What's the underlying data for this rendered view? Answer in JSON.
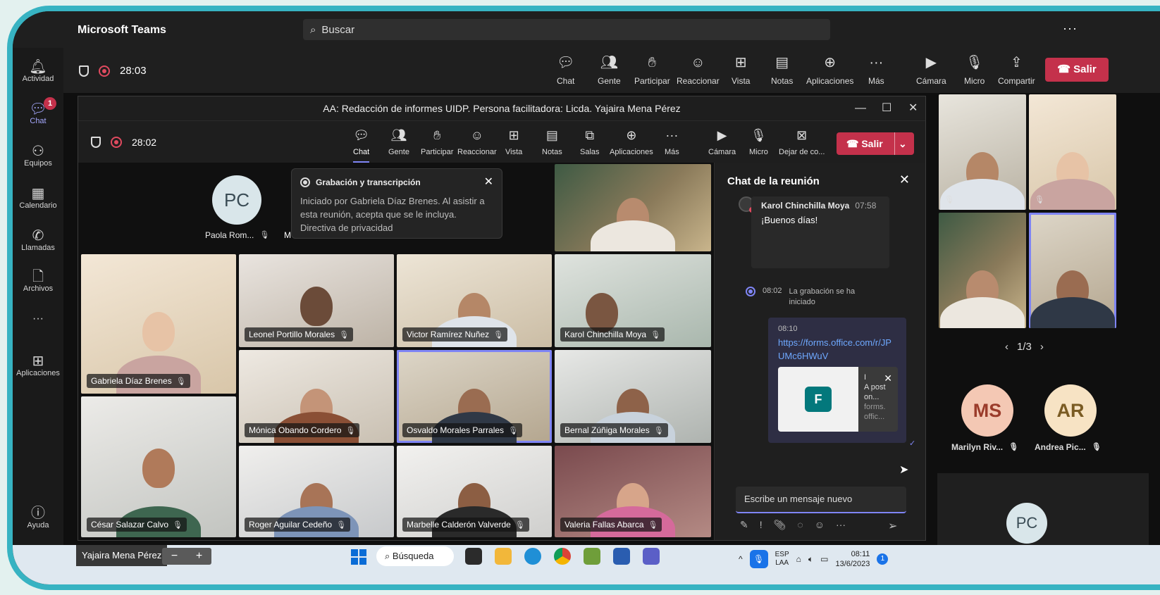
{
  "top": {
    "app_name": "Microsoft Teams",
    "search_placeholder": "Buscar",
    "more": "···"
  },
  "rail": [
    {
      "label": "Actividad",
      "icon": "bell-icon"
    },
    {
      "label": "Chat",
      "icon": "chat-icon",
      "badge": "1"
    },
    {
      "label": "Equipos",
      "icon": "teams-icon"
    },
    {
      "label": "Calendario",
      "icon": "calendar-icon"
    },
    {
      "label": "Llamadas",
      "icon": "phone-icon"
    },
    {
      "label": "Archivos",
      "icon": "file-icon"
    },
    {
      "label": "···",
      "icon": "more-icon"
    },
    {
      "label": "Aplicaciones",
      "icon": "apps-icon"
    },
    {
      "label": "Ayuda",
      "icon": "help-icon"
    }
  ],
  "toolbar": {
    "timer": "28:03",
    "buttons": [
      "Chat",
      "Gente",
      "Participar",
      "Reaccionar",
      "Vista",
      "Notas",
      "Aplicaciones",
      "Más",
      "Cámara",
      "Micro",
      "Compartir"
    ],
    "leave": "Salir"
  },
  "inner": {
    "title": "AA: Redacción de informes UIDP. Persona facilitadora: Licda. Yajaira Mena Pérez",
    "timer": "28:02",
    "buttons": [
      "Chat",
      "Gente",
      "Participar",
      "Reaccionar",
      "Vista",
      "Notas",
      "Salas",
      "Aplicaciones",
      "Más",
      "Cámara",
      "Micro",
      "Dejar de co..."
    ],
    "leave": "Salir"
  },
  "toast": {
    "title": "Grabación y transcripción",
    "body": "Iniciado por Gabriela Díaz Brenes. Al asistir a esta reunión, acepta que se le incluya. Directiva de privacidad"
  },
  "stage": {
    "pc_initials": "PC",
    "pc_name": "Paola Rom...",
    "m_cut": "M",
    "participants": [
      "Gabriela Díaz Brenes",
      "Leonel Portillo Morales",
      "Victor Ramírez Nuñez",
      "Karol Chinchilla Moya",
      "Mónica Obando Cordero",
      "Osvaldo Morales Parrales",
      "Bernal Zúñiga Morales",
      "César Salazar Calvo",
      "Roger Aguilar Cedeño",
      "Marbelle Calderón Valverde",
      "Valeria Fallas Abarca"
    ]
  },
  "chat": {
    "title": "Chat de la reunión",
    "msg1_author": "Karol Chinchilla Moya",
    "msg1_time": "07:58",
    "msg1_text": "¡Buenos días!",
    "sys_time": "08:02",
    "sys_text": "La grabación se ha iniciado",
    "msg2_time": "08:10",
    "msg2_link": "https://forms.office.com/r/JPUMc6HWuV",
    "card_text": "I",
    "card_desc": "A post on...",
    "card_domain": "forms. offic...",
    "compose_placeholder": "Escribe un mensaje nuevo"
  },
  "right": {
    "pager": "1/3",
    "ms_initials": "MS",
    "ms_name": "Marilyn Riv...",
    "ar_initials": "AR",
    "ar_name": "Andrea Pic...",
    "pc_initials": "PC"
  },
  "taskbar": {
    "user": "Yajaira Mena Pérez",
    "search": "Búsqueda",
    "lang1": "ESP",
    "lang2": "LAA",
    "time": "08:11",
    "date": "13/6/2023",
    "notif": "1"
  },
  "colors": {
    "accent": "#7f85f5",
    "leave": "#c4314b",
    "border": "#37b3c2"
  }
}
